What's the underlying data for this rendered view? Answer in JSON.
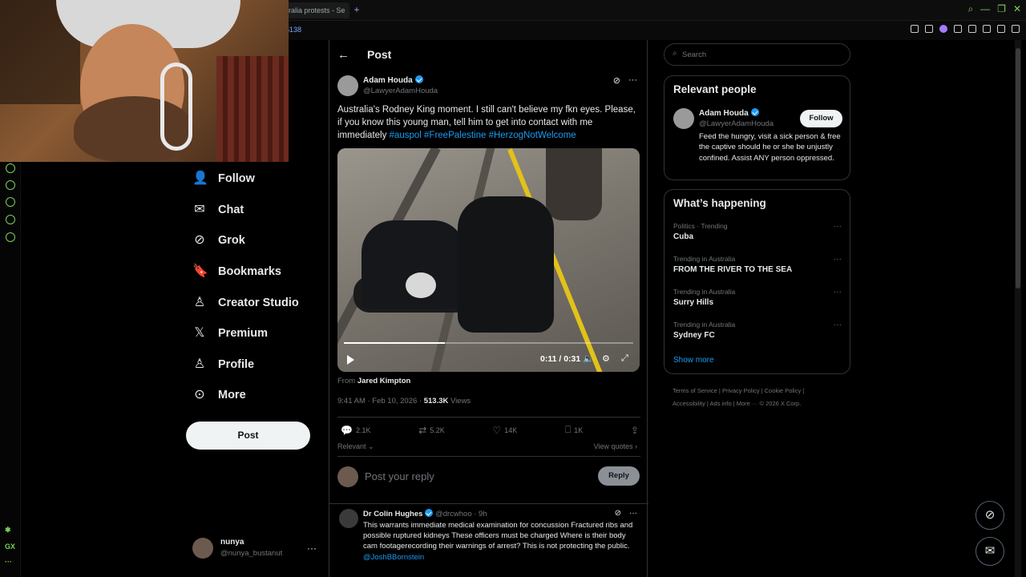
{
  "browser": {
    "tab_title": "ralia protests - Se",
    "url_fragment": "5138"
  },
  "nav": {
    "items": [
      {
        "label": "Follow",
        "icon": "person-plus-icon",
        "glyph": "👤"
      },
      {
        "label": "Chat",
        "icon": "envelope-icon",
        "glyph": "✉"
      },
      {
        "label": "Grok",
        "icon": "grok-icon",
        "glyph": "⊘"
      },
      {
        "label": "Bookmarks",
        "icon": "bookmark-icon",
        "glyph": "🔖"
      },
      {
        "label": "Creator Studio",
        "icon": "creator-studio-icon",
        "glyph": "♙"
      },
      {
        "label": "Premium",
        "icon": "x-logo-icon",
        "glyph": "𝕏"
      },
      {
        "label": "Profile",
        "icon": "person-icon",
        "glyph": "♙"
      },
      {
        "label": "More",
        "icon": "more-circle-icon",
        "glyph": "⊙"
      }
    ],
    "post_button": "Post"
  },
  "account": {
    "name": "nunya",
    "handle": "@nunya_bustanut"
  },
  "header": {
    "title": "Post"
  },
  "post": {
    "author_name": "Adam Houda",
    "author_handle": "@LawyerAdamHouda",
    "text": "Australia's Rodney King moment. I still can't believe my fkn eyes. Please, if you know this young man, tell him to get into contact with me immediately ",
    "hashtags": "#auspol #FreePalestine #HerzogNotWelcome",
    "video": {
      "time": "0:11 / 0:31",
      "progress": 0.35
    },
    "from_label": "From",
    "from_name": "Jared Kimpton",
    "timestamp": "9:41 AM · Feb 10, 2026 · ",
    "views_count": "513.3K",
    "views_label": " Views",
    "actions": {
      "replies": "2.1K",
      "reposts": "5.2K",
      "likes": "14K",
      "bookmarks": "1K"
    },
    "sort_label": "Relevant ⌄",
    "view_quotes": "View quotes ›"
  },
  "reply_box": {
    "placeholder": "Post your reply",
    "button": "Reply"
  },
  "reply": {
    "author_name": "Dr Colin Hughes",
    "handle_time": "@drcwhoo · 9h",
    "text": "This warrants immediate medical examination for concussion Fractured ribs and possible ruptured kidneys These officers must be charged Where is their body cam footagerecording their warnings of arrest? This is not protecting the public. ",
    "mention": "@JoshBBornstein"
  },
  "search": {
    "placeholder": "Search"
  },
  "relevant_people": {
    "title": "Relevant people",
    "name": "Adam Houda",
    "handle": "@LawyerAdamHouda",
    "follow": "Follow",
    "bio": "Feed the hungry, visit a sick person & free the captive should he or she be unjustly confined. Assist ANY person oppressed."
  },
  "happening": {
    "title": "What’s happening",
    "trends": [
      {
        "context": "Politics · Trending",
        "name": "Cuba"
      },
      {
        "context": "Trending in Australia",
        "name": "FROM THE RIVER TO THE SEA"
      },
      {
        "context": "Trending in Australia",
        "name": "Surry Hills"
      },
      {
        "context": "Trending in Australia",
        "name": "Sydney FC"
      }
    ],
    "show_more": "Show more"
  },
  "footer": {
    "line1": "Terms of Service  |  Privacy Policy  |  Cookie Policy  |",
    "line2": "Accessibility  |  Ads info  |  More ···  © 2026 X Corp."
  },
  "left_strip": {
    "label": "GX"
  },
  "colors": {
    "accent": "#1d9bf0",
    "gx_green": "#7ad15a",
    "background": "#000000"
  }
}
